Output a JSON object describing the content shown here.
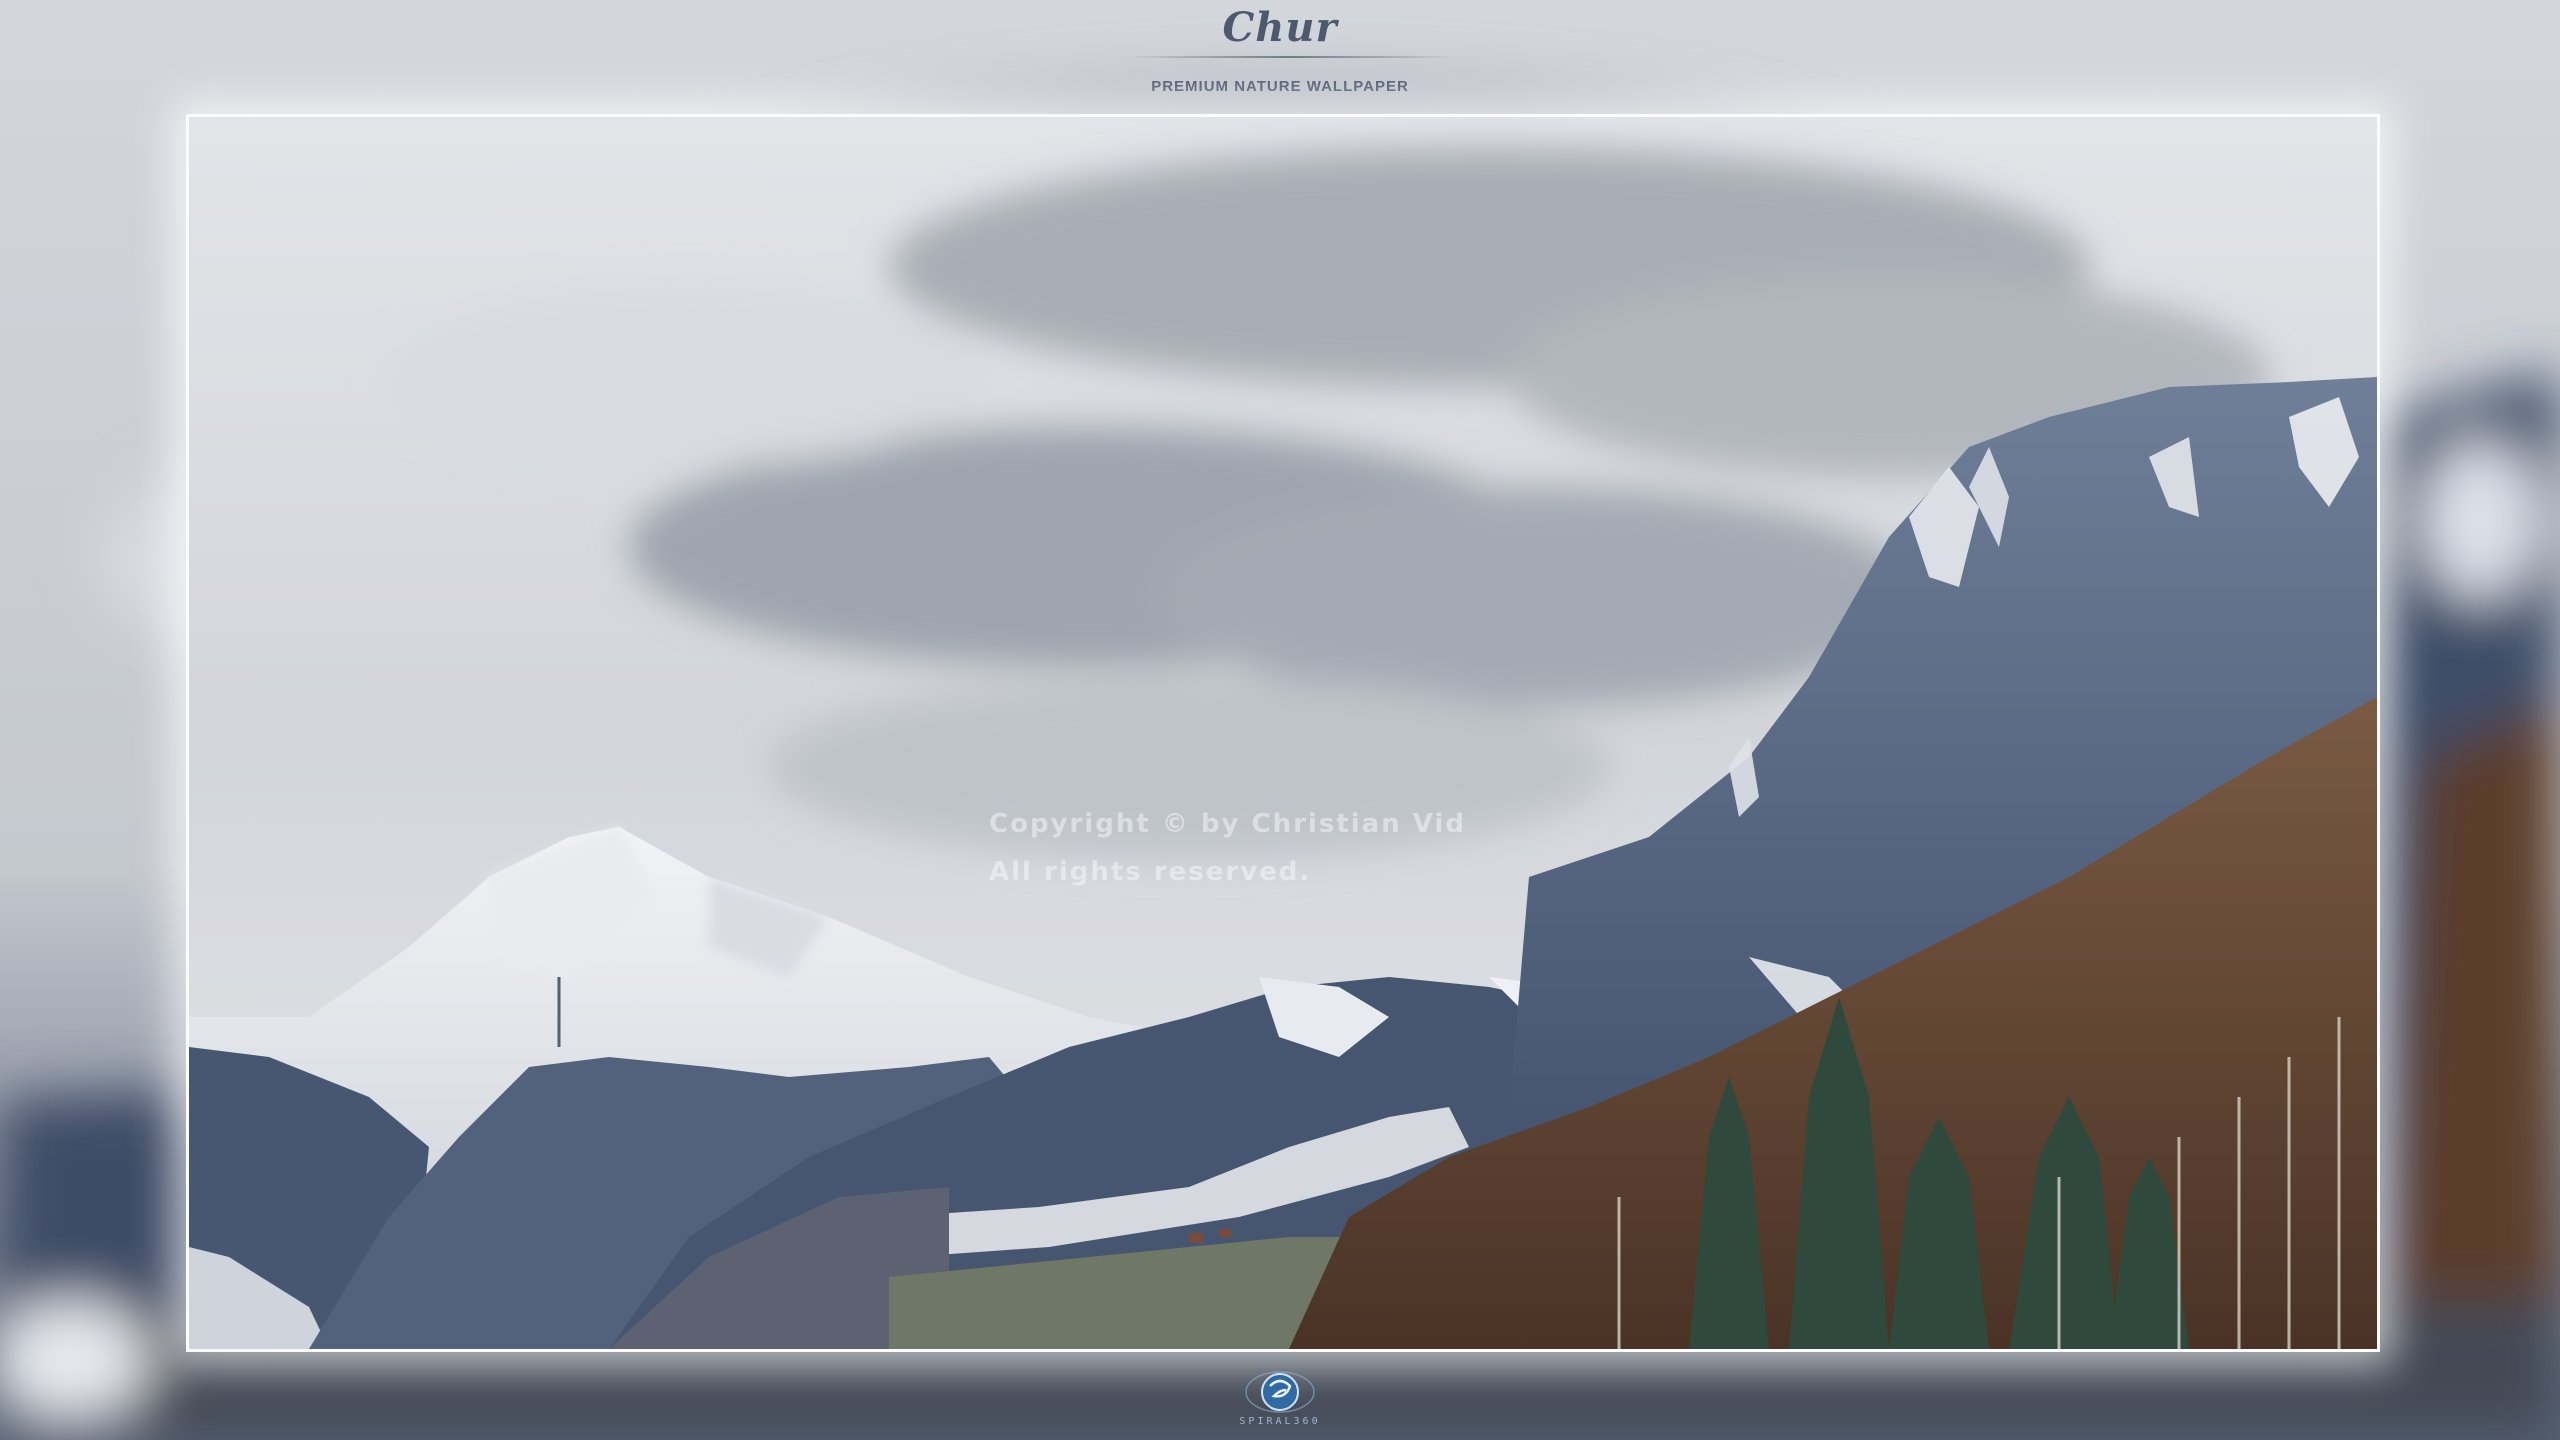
{
  "header": {
    "brand": "Chur",
    "subtitle": "PREMIUM NATURE WALLPAPER"
  },
  "watermark": {
    "line1": "Copyright © by Christian Vid",
    "line2": "All rights reserved."
  },
  "footer": {
    "logo_icon": "spiral-globe-icon",
    "logo_text": "SPIRAL360"
  },
  "colors": {
    "brand": "#4d5a6e",
    "sky": "#dcdfe3",
    "forest_snow": "#4a5e7c",
    "autumn_trees": "#6b4a34"
  }
}
